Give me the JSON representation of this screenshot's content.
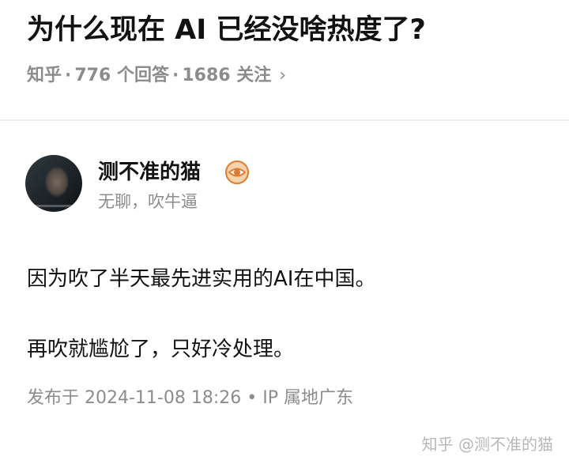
{
  "question": {
    "title": "为什么现在 AI 已经没啥热度了?",
    "source": "知乎",
    "separator": "·",
    "answers": "776 个回答",
    "follows": "1686 关注",
    "chevron": "›"
  },
  "answer": {
    "author": {
      "name": "测不准的猫",
      "bio": "无聊，吹牛逼",
      "badge_icon": "eye-badge-icon"
    },
    "paragraphs": [
      "因为吹了半天最先进实用的AI在中国。",
      "再吹就尴尬了，只好冷处理。"
    ],
    "published": "发布于 2024-11-08 18:26",
    "meta_dot": "•",
    "location": "IP 属地广东"
  },
  "watermark": "知乎 @测不准的猫",
  "colors": {
    "text": "#121212",
    "muted": "#8c8c8c",
    "divider": "#f1f1f1",
    "badge": "#e07a2e"
  }
}
